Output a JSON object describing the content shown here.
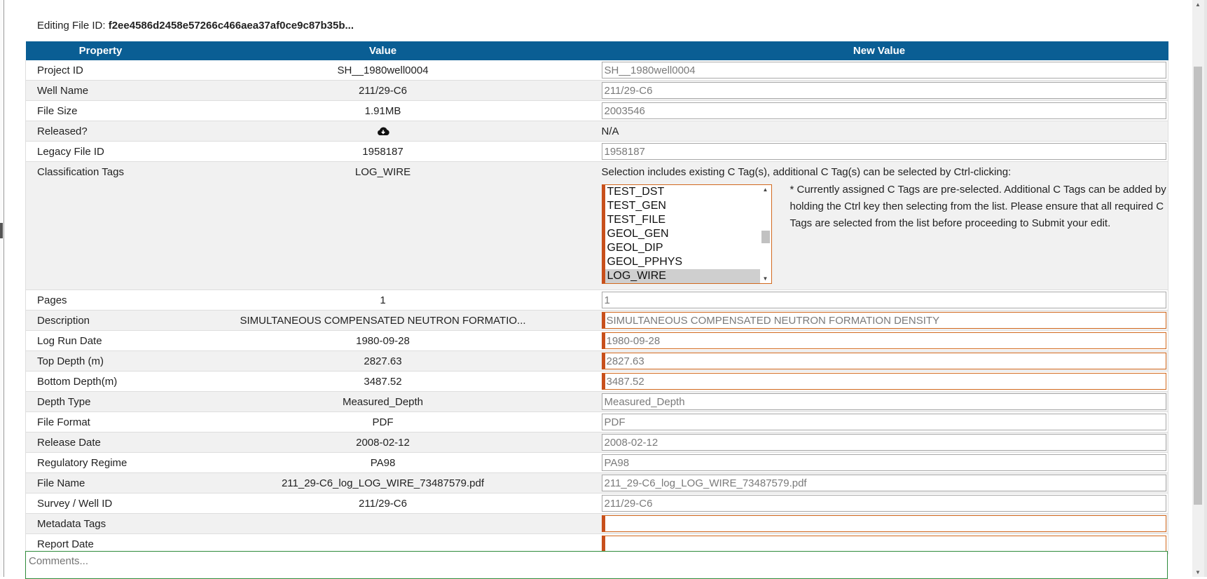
{
  "header": {
    "editing_label": "Editing File ID:",
    "file_id": "f2ee4586d2458e57266c466aea37af0ce9c87b35b..."
  },
  "table": {
    "columns": [
      "Property",
      "Value",
      "New Value"
    ],
    "rows": [
      {
        "property": "Project ID",
        "value": "SH__1980well0004",
        "new_value": "SH__1980well0004",
        "required": false
      },
      {
        "property": "Well Name",
        "value": "211/29-C6",
        "new_value": "211/29-C6",
        "required": false
      },
      {
        "property": "File Size",
        "value": "1.91MB",
        "new_value": "2003546",
        "required": false
      },
      {
        "property": "Released?",
        "value_icon": "cloud-download-icon",
        "new_value_text": "N/A"
      },
      {
        "property": "Legacy File ID",
        "value": "1958187",
        "new_value": "1958187",
        "required": false
      },
      {
        "property": "Classification Tags",
        "value": "LOG_WIRE"
      },
      {
        "property": "Pages",
        "value": "1",
        "new_value": "1",
        "required": false
      },
      {
        "property": "Description",
        "value": "SIMULTANEOUS COMPENSATED NEUTRON FORMATIO...",
        "new_value": "SIMULTANEOUS COMPENSATED NEUTRON FORMATION DENSITY",
        "required": true
      },
      {
        "property": "Log Run Date",
        "value": "1980-09-28",
        "new_value": "1980-09-28",
        "required": true
      },
      {
        "property": "Top Depth (m)",
        "value": "2827.63",
        "new_value": "2827.63",
        "required": true
      },
      {
        "property": "Bottom Depth(m)",
        "value": "3487.52",
        "new_value": "3487.52",
        "required": true
      },
      {
        "property": "Depth Type",
        "value": "Measured_Depth",
        "new_value": "Measured_Depth",
        "required": false
      },
      {
        "property": "File Format",
        "value": "PDF",
        "new_value": "PDF",
        "required": false
      },
      {
        "property": "Release Date",
        "value": "2008-02-12",
        "new_value": "2008-02-12",
        "required": false
      },
      {
        "property": "Regulatory Regime",
        "value": "PA98",
        "new_value": "PA98",
        "required": false
      },
      {
        "property": "File Name",
        "value": "211_29-C6_log_LOG_WIRE_73487579.pdf",
        "new_value": "211_29-C6_log_LOG_WIRE_73487579.pdf",
        "required": false
      },
      {
        "property": "Survey / Well ID",
        "value": "211/29-C6",
        "new_value": "211/29-C6",
        "required": false
      },
      {
        "property": "Metadata Tags",
        "value": "",
        "new_value": "",
        "required": true
      },
      {
        "property": "Report Date",
        "value": "",
        "new_value": "",
        "required": true
      }
    ]
  },
  "classification": {
    "hint": "Selection includes existing C Tag(s), additional C Tag(s) can be selected by Ctrl-clicking:",
    "options": [
      "TEST_DST",
      "TEST_GEN",
      "TEST_FILE",
      "GEOL_GEN",
      "GEOL_DIP",
      "GEOL_PPHYS",
      "LOG_WIRE"
    ],
    "selected": "LOG_WIRE",
    "note": "* Currently assigned C Tags are pre-selected. Additional C Tags can be added by holding the Ctrl key then selecting from the list. Please ensure that all required C Tags are selected from the list before proceeding to Submit your edit."
  },
  "comments": {
    "placeholder": "Comments..."
  },
  "colors": {
    "header_bg": "#0a5e94",
    "required_accent": "#c8501c",
    "comments_border": "#2e8b3a"
  }
}
